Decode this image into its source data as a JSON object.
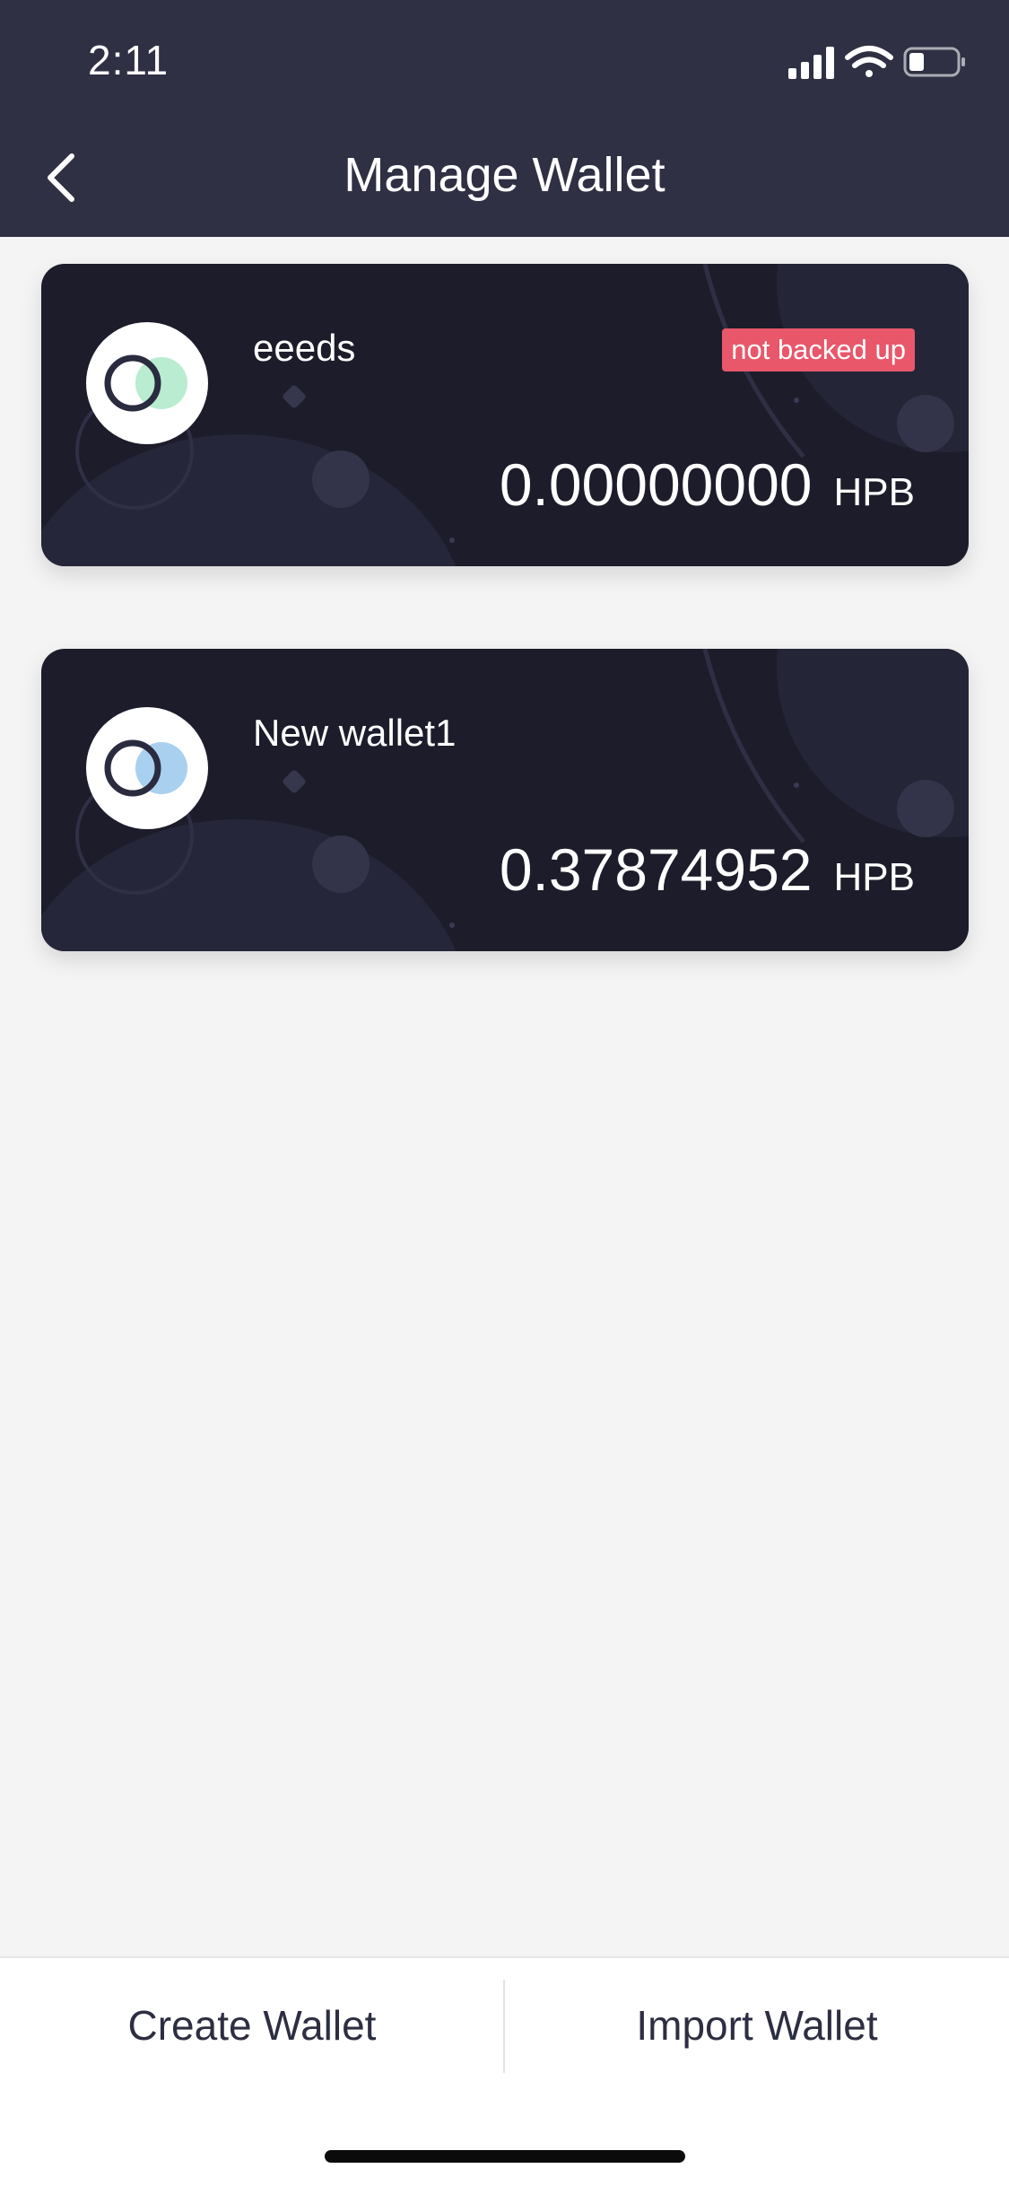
{
  "status_bar": {
    "time": "2:11"
  },
  "nav": {
    "title": "Manage Wallet",
    "back_icon": "chevron-left-icon"
  },
  "wallets": [
    {
      "name": "eeeds",
      "badge": "not backed up",
      "balance": "0.00000000",
      "unit": "HPB",
      "avatar_accent": "#b9ecd0"
    },
    {
      "name": "New wallet1",
      "badge": "",
      "balance": "0.37874952",
      "unit": "HPB",
      "avatar_accent": "#a9d0ef"
    }
  ],
  "actions": {
    "create_label": "Create Wallet",
    "import_label": "Import Wallet"
  },
  "colors": {
    "header_bg": "#2f3044",
    "card_bg": "#1c1c2b",
    "badge_bg": "#e8576a",
    "page_bg": "#f4f4f5"
  }
}
